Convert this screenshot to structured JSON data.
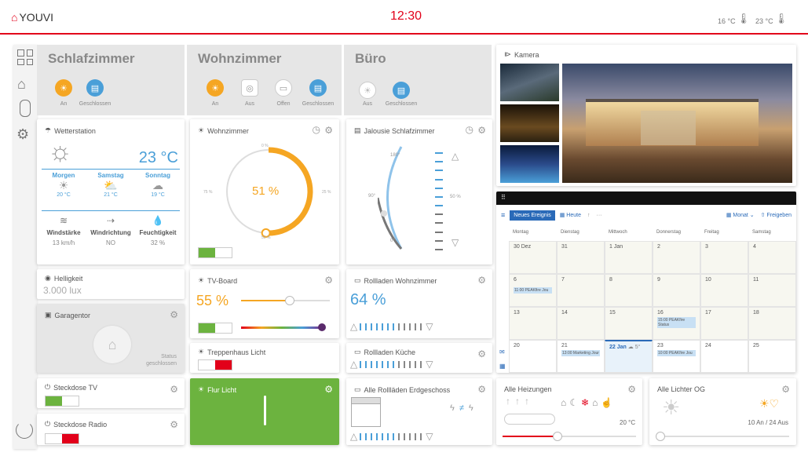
{
  "header": {
    "logo": "YOUVI",
    "time": "12:30",
    "temp_out": "16 °C",
    "temp_in": "23 °C"
  },
  "rooms": [
    {
      "name": "Schlafzimmer",
      "buttons": [
        "An",
        "Geschlossen"
      ]
    },
    {
      "name": "Wohnzimmer",
      "buttons": [
        "An",
        "Aus",
        "Offen",
        "Geschlossen"
      ]
    },
    {
      "name": "Büro",
      "buttons": [
        "Aus",
        "Geschlossen"
      ]
    }
  ],
  "weather": {
    "title": "Wetterstation",
    "temp": "23 °C",
    "days": [
      {
        "name": "Morgen",
        "temp": "20 °C"
      },
      {
        "name": "Samstag",
        "temp": "21 °C"
      },
      {
        "name": "Sonntag",
        "temp": "19 °C"
      }
    ],
    "metrics": [
      {
        "label": "Windstärke",
        "value": "13 km/h"
      },
      {
        "label": "Windrichtung",
        "value": "NO"
      },
      {
        "label": "Feuchtigkeit",
        "value": "32 %"
      }
    ]
  },
  "wohnzimmer": {
    "title": "Wohnzimmer",
    "value": "51 %",
    "ticks": [
      "0 %",
      "25 %",
      "50 %",
      "75 %"
    ],
    "level": 0.51
  },
  "jalousie": {
    "title": "Jalousie Schlafzimmer",
    "angles": [
      "180°",
      "90°",
      "0°"
    ],
    "pos": "50 %"
  },
  "helligkeit": {
    "title": "Helligkeit",
    "value": "3.000 lux"
  },
  "garage": {
    "title": "Garagentor",
    "status_label": "Status",
    "status": "geschlossen"
  },
  "tvboard": {
    "title": "TV-Board",
    "value": "55 %",
    "level": 0.55
  },
  "treppe": {
    "title": "Treppenhaus Licht"
  },
  "flur": {
    "title": "Flur Licht"
  },
  "rollladen_wohn": {
    "title": "Rollladen Wohnzimmer",
    "value": "64 %"
  },
  "rollladen_kueche": {
    "title": "Rollladen Küche"
  },
  "alle_rollladen": {
    "title": "Alle Rollläden Erdgeschoss"
  },
  "steckdose_tv": {
    "title": "Steckdose TV"
  },
  "steckdose_radio": {
    "title": "Steckdose Radio"
  },
  "kamera": {
    "title": "Kamera"
  },
  "calendar": {
    "new_event": "Neues Ereignis",
    "today": "Heute",
    "more": "···",
    "view": "Monat",
    "share": "Freigeben",
    "weekdays": [
      "Montag",
      "Dienstag",
      "Mittwoch",
      "Donnerstag",
      "Freitag",
      "Samstag"
    ],
    "weeks": [
      [
        "30 Dez",
        "31",
        "1 Jan",
        "2",
        "3",
        "4"
      ],
      [
        "6",
        "7",
        "8",
        "9",
        "10",
        "11"
      ],
      [
        "13",
        "14",
        "15",
        "16",
        "17",
        "18"
      ],
      [
        "20",
        "21",
        "22 Jan",
        "23",
        "24",
        "25"
      ]
    ],
    "events": {
      "e1": "11:00 PEAKfire Jou",
      "e2": "15:00 PEAKfire Status",
      "e3": "13:00 Marketing Jour",
      "e4": "10:00 PEAKfire Jou",
      "w": "5°"
    }
  },
  "heizungen": {
    "title": "Alle Heizungen",
    "temp": "20 °C"
  },
  "lichter": {
    "title": "Alle Lichter OG",
    "status": "10 An / 24 Aus"
  },
  "colors": {
    "accent": "#f5a623",
    "blue": "#4a9fd8",
    "red": "#e2001a",
    "green": "#6cb33f"
  }
}
